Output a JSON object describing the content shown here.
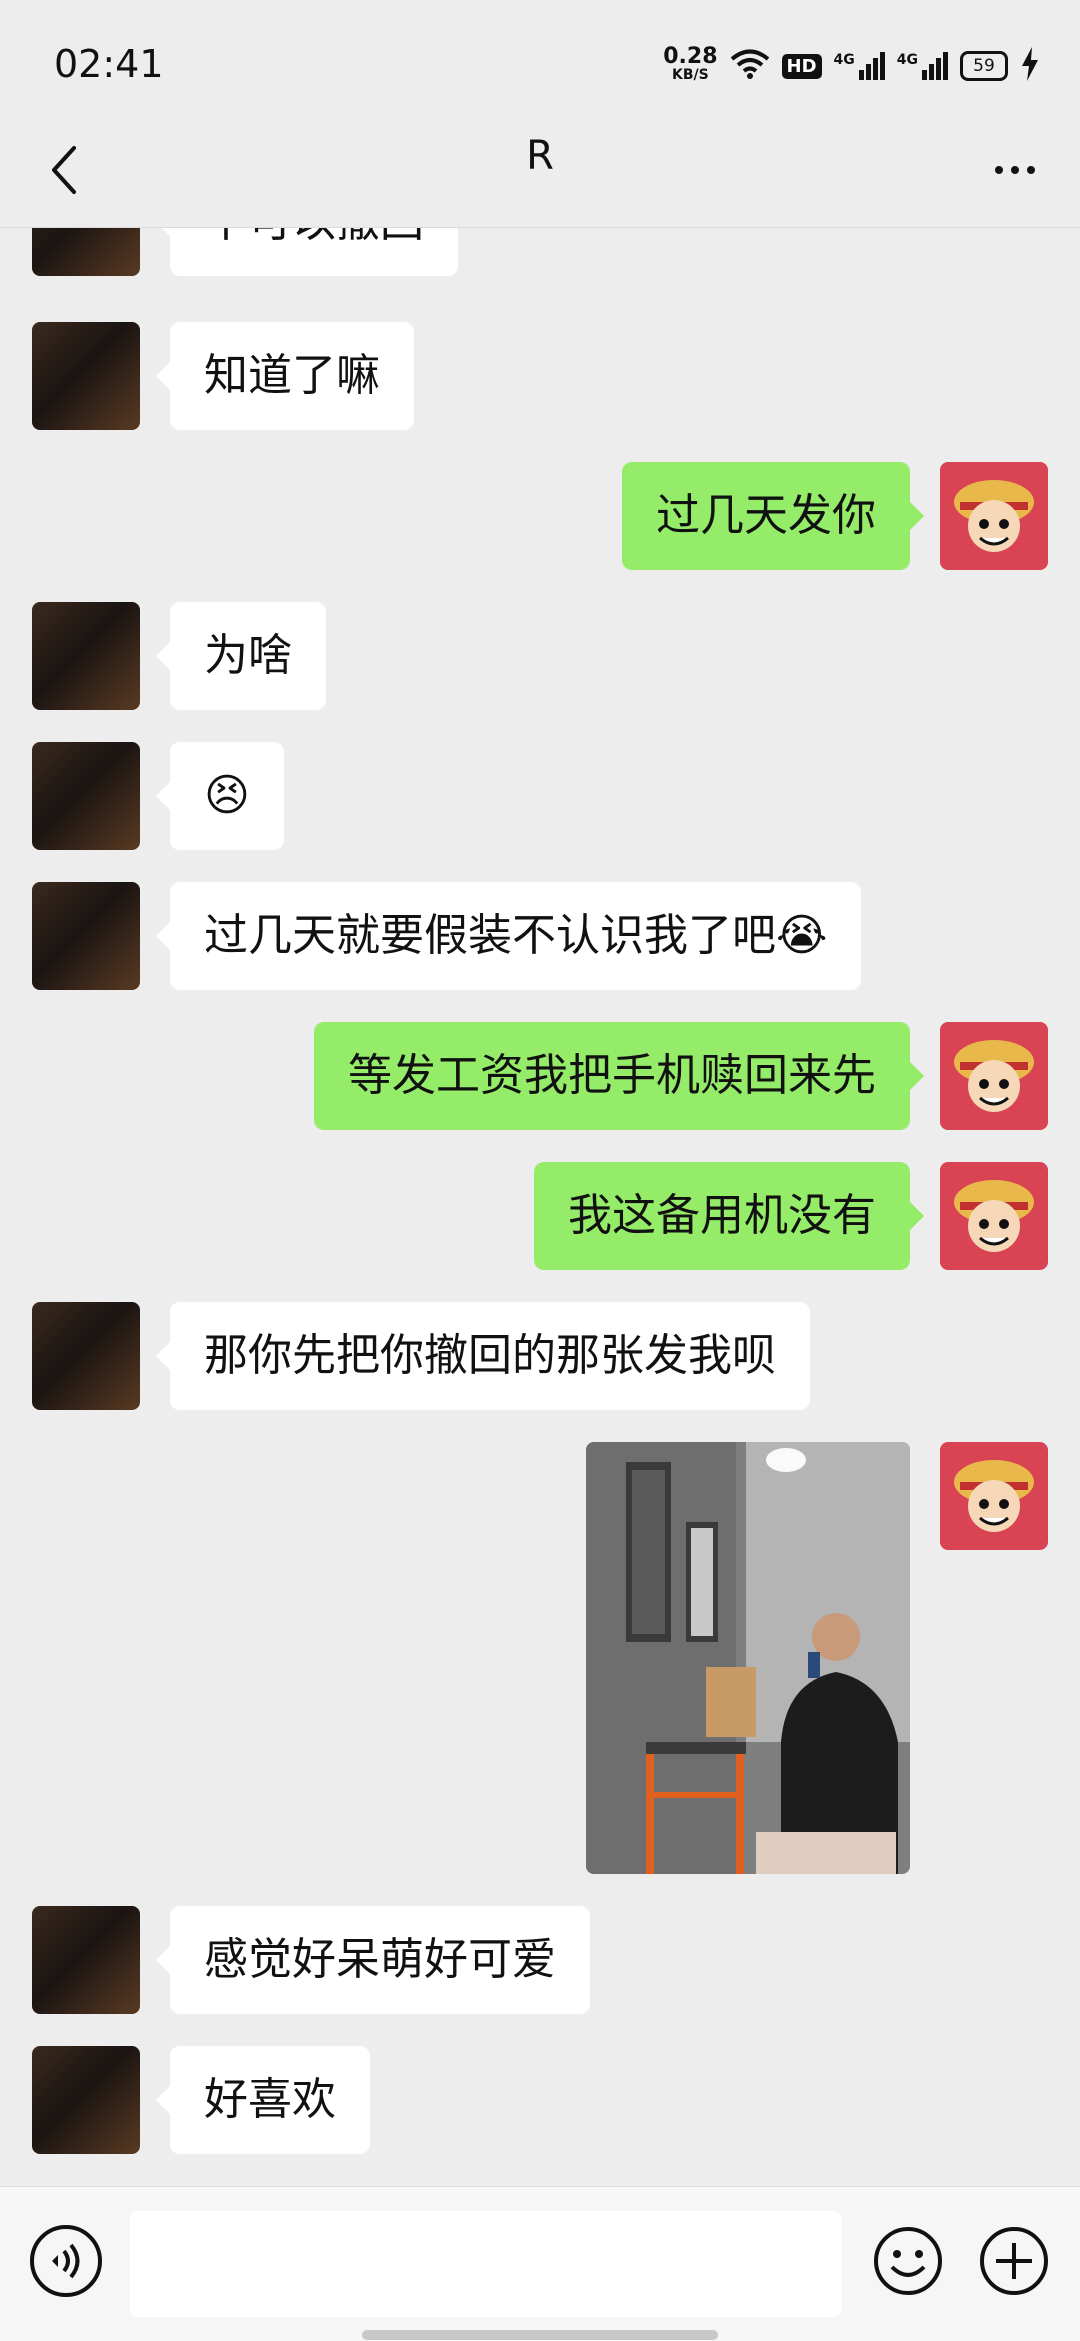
{
  "status_bar": {
    "time": "02:41",
    "net_speed_value": "0.28",
    "net_speed_unit": "KB/S",
    "hd_label": "HD",
    "network_1": "4G",
    "network_2": "4G",
    "battery": "59"
  },
  "header": {
    "title": "R"
  },
  "messages": [
    {
      "side": "in",
      "text": "不可以撤回"
    },
    {
      "side": "in",
      "text": "知道了嘛"
    },
    {
      "side": "out",
      "text": "过几天发你"
    },
    {
      "side": "in",
      "text": "为啥"
    },
    {
      "side": "in",
      "text": "😣"
    },
    {
      "side": "in",
      "text": "过几天就要假装不认识我了吧😭"
    },
    {
      "side": "out",
      "text": "等发工资我把手机赎回来先"
    },
    {
      "side": "out",
      "text": "我这备用机没有"
    },
    {
      "side": "in",
      "text": "那你先把你撤回的那张发我呗"
    },
    {
      "side": "out",
      "type": "image"
    },
    {
      "side": "in",
      "text": "感觉好呆萌好可爱"
    },
    {
      "side": "in",
      "text": "好喜欢"
    }
  ],
  "input_bar": {
    "placeholder": ""
  },
  "icons": {
    "back": "back-arrow-icon",
    "more": "more-dots-icon",
    "voice": "voice-icon",
    "emoji": "emoji-icon",
    "plus": "plus-icon",
    "wifi": "wifi-icon",
    "charging": "charging-bolt-icon"
  },
  "colors": {
    "background": "#ededed",
    "bubble_in": "#ffffff",
    "bubble_out": "#95ec69",
    "self_avatar": "#d94454"
  }
}
